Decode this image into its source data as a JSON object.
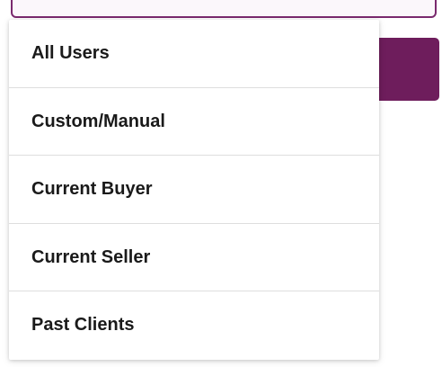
{
  "dropdown": {
    "options": [
      {
        "label": "All Users"
      },
      {
        "label": "Custom/Manual"
      },
      {
        "label": "Current Buyer"
      },
      {
        "label": "Current Seller"
      },
      {
        "label": "Past Clients"
      }
    ]
  },
  "colors": {
    "accent": "#6e1d5c",
    "field_border": "#7a2a6e",
    "divider": "#dedede",
    "text": "#1a1a1a"
  }
}
